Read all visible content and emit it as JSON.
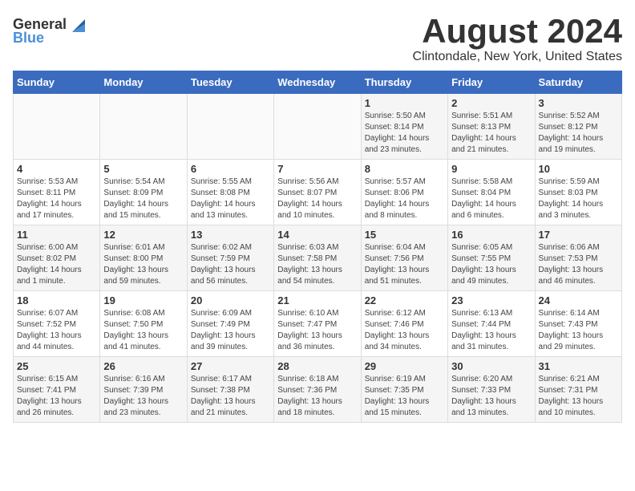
{
  "header": {
    "logo_general": "General",
    "logo_blue": "Blue",
    "title": "August 2024",
    "subtitle": "Clintondale, New York, United States"
  },
  "weekdays": [
    "Sunday",
    "Monday",
    "Tuesday",
    "Wednesday",
    "Thursday",
    "Friday",
    "Saturday"
  ],
  "weeks": [
    [
      {
        "day": "",
        "content": ""
      },
      {
        "day": "",
        "content": ""
      },
      {
        "day": "",
        "content": ""
      },
      {
        "day": "",
        "content": ""
      },
      {
        "day": "1",
        "content": "Sunrise: 5:50 AM\nSunset: 8:14 PM\nDaylight: 14 hours\nand 23 minutes."
      },
      {
        "day": "2",
        "content": "Sunrise: 5:51 AM\nSunset: 8:13 PM\nDaylight: 14 hours\nand 21 minutes."
      },
      {
        "day": "3",
        "content": "Sunrise: 5:52 AM\nSunset: 8:12 PM\nDaylight: 14 hours\nand 19 minutes."
      }
    ],
    [
      {
        "day": "4",
        "content": "Sunrise: 5:53 AM\nSunset: 8:11 PM\nDaylight: 14 hours\nand 17 minutes."
      },
      {
        "day": "5",
        "content": "Sunrise: 5:54 AM\nSunset: 8:09 PM\nDaylight: 14 hours\nand 15 minutes."
      },
      {
        "day": "6",
        "content": "Sunrise: 5:55 AM\nSunset: 8:08 PM\nDaylight: 14 hours\nand 13 minutes."
      },
      {
        "day": "7",
        "content": "Sunrise: 5:56 AM\nSunset: 8:07 PM\nDaylight: 14 hours\nand 10 minutes."
      },
      {
        "day": "8",
        "content": "Sunrise: 5:57 AM\nSunset: 8:06 PM\nDaylight: 14 hours\nand 8 minutes."
      },
      {
        "day": "9",
        "content": "Sunrise: 5:58 AM\nSunset: 8:04 PM\nDaylight: 14 hours\nand 6 minutes."
      },
      {
        "day": "10",
        "content": "Sunrise: 5:59 AM\nSunset: 8:03 PM\nDaylight: 14 hours\nand 3 minutes."
      }
    ],
    [
      {
        "day": "11",
        "content": "Sunrise: 6:00 AM\nSunset: 8:02 PM\nDaylight: 14 hours\nand 1 minute."
      },
      {
        "day": "12",
        "content": "Sunrise: 6:01 AM\nSunset: 8:00 PM\nDaylight: 13 hours\nand 59 minutes."
      },
      {
        "day": "13",
        "content": "Sunrise: 6:02 AM\nSunset: 7:59 PM\nDaylight: 13 hours\nand 56 minutes."
      },
      {
        "day": "14",
        "content": "Sunrise: 6:03 AM\nSunset: 7:58 PM\nDaylight: 13 hours\nand 54 minutes."
      },
      {
        "day": "15",
        "content": "Sunrise: 6:04 AM\nSunset: 7:56 PM\nDaylight: 13 hours\nand 51 minutes."
      },
      {
        "day": "16",
        "content": "Sunrise: 6:05 AM\nSunset: 7:55 PM\nDaylight: 13 hours\nand 49 minutes."
      },
      {
        "day": "17",
        "content": "Sunrise: 6:06 AM\nSunset: 7:53 PM\nDaylight: 13 hours\nand 46 minutes."
      }
    ],
    [
      {
        "day": "18",
        "content": "Sunrise: 6:07 AM\nSunset: 7:52 PM\nDaylight: 13 hours\nand 44 minutes."
      },
      {
        "day": "19",
        "content": "Sunrise: 6:08 AM\nSunset: 7:50 PM\nDaylight: 13 hours\nand 41 minutes."
      },
      {
        "day": "20",
        "content": "Sunrise: 6:09 AM\nSunset: 7:49 PM\nDaylight: 13 hours\nand 39 minutes."
      },
      {
        "day": "21",
        "content": "Sunrise: 6:10 AM\nSunset: 7:47 PM\nDaylight: 13 hours\nand 36 minutes."
      },
      {
        "day": "22",
        "content": "Sunrise: 6:12 AM\nSunset: 7:46 PM\nDaylight: 13 hours\nand 34 minutes."
      },
      {
        "day": "23",
        "content": "Sunrise: 6:13 AM\nSunset: 7:44 PM\nDaylight: 13 hours\nand 31 minutes."
      },
      {
        "day": "24",
        "content": "Sunrise: 6:14 AM\nSunset: 7:43 PM\nDaylight: 13 hours\nand 29 minutes."
      }
    ],
    [
      {
        "day": "25",
        "content": "Sunrise: 6:15 AM\nSunset: 7:41 PM\nDaylight: 13 hours\nand 26 minutes."
      },
      {
        "day": "26",
        "content": "Sunrise: 6:16 AM\nSunset: 7:39 PM\nDaylight: 13 hours\nand 23 minutes."
      },
      {
        "day": "27",
        "content": "Sunrise: 6:17 AM\nSunset: 7:38 PM\nDaylight: 13 hours\nand 21 minutes."
      },
      {
        "day": "28",
        "content": "Sunrise: 6:18 AM\nSunset: 7:36 PM\nDaylight: 13 hours\nand 18 minutes."
      },
      {
        "day": "29",
        "content": "Sunrise: 6:19 AM\nSunset: 7:35 PM\nDaylight: 13 hours\nand 15 minutes."
      },
      {
        "day": "30",
        "content": "Sunrise: 6:20 AM\nSunset: 7:33 PM\nDaylight: 13 hours\nand 13 minutes."
      },
      {
        "day": "31",
        "content": "Sunrise: 6:21 AM\nSunset: 7:31 PM\nDaylight: 13 hours\nand 10 minutes."
      }
    ]
  ]
}
